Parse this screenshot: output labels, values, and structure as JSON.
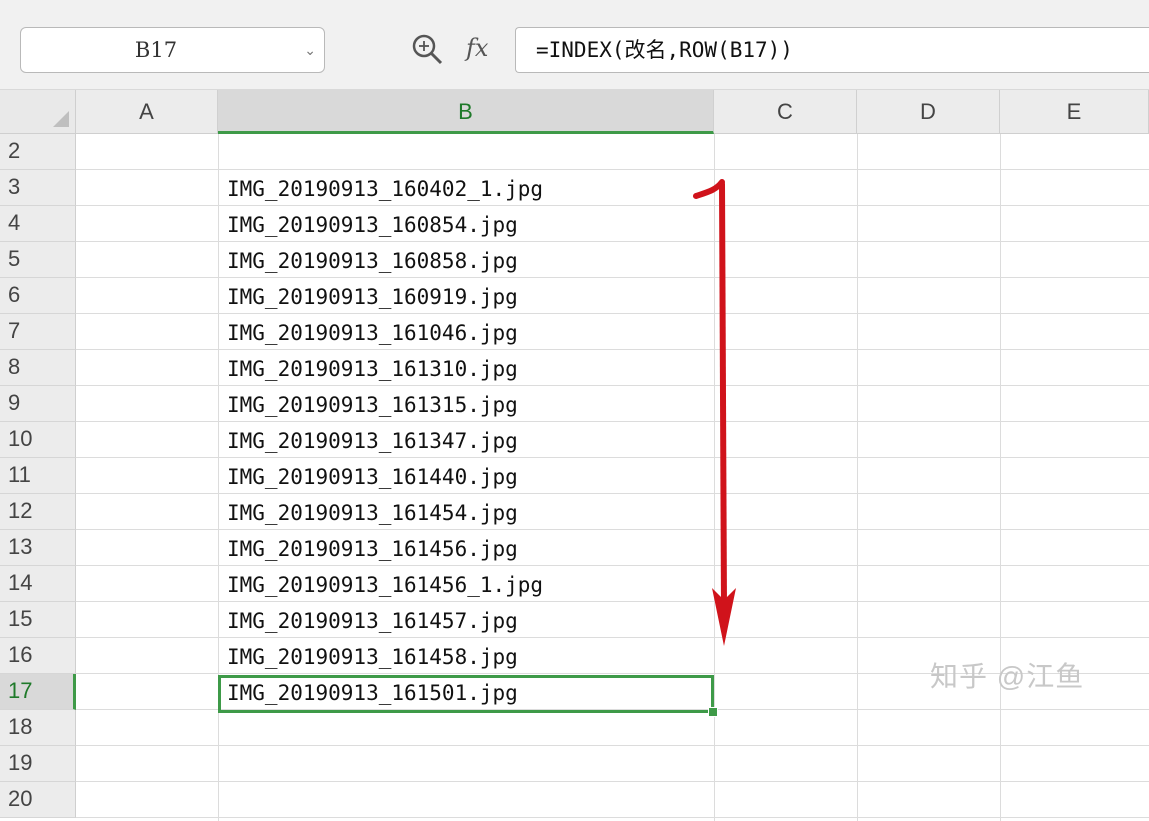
{
  "formula_bar": {
    "name_box_value": "B17",
    "name_box_caret": "⌄",
    "fx_label": "fx",
    "formula": "=INDEX(改名,ROW(B17))"
  },
  "columns": [
    "A",
    "B",
    "C",
    "D",
    "E"
  ],
  "rows": [
    {
      "num": "2",
      "b": ""
    },
    {
      "num": "3",
      "b": "IMG_20190913_160402_1.jpg"
    },
    {
      "num": "4",
      "b": "IMG_20190913_160854.jpg"
    },
    {
      "num": "5",
      "b": "IMG_20190913_160858.jpg"
    },
    {
      "num": "6",
      "b": "IMG_20190913_160919.jpg"
    },
    {
      "num": "7",
      "b": "IMG_20190913_161046.jpg"
    },
    {
      "num": "8",
      "b": "IMG_20190913_161310.jpg"
    },
    {
      "num": "9",
      "b": "IMG_20190913_161315.jpg"
    },
    {
      "num": "10",
      "b": "IMG_20190913_161347.jpg"
    },
    {
      "num": "11",
      "b": "IMG_20190913_161440.jpg"
    },
    {
      "num": "12",
      "b": "IMG_20190913_161454.jpg"
    },
    {
      "num": "13",
      "b": "IMG_20190913_161456.jpg"
    },
    {
      "num": "14",
      "b": "IMG_20190913_161456_1.jpg"
    },
    {
      "num": "15",
      "b": "IMG_20190913_161457.jpg"
    },
    {
      "num": "16",
      "b": "IMG_20190913_161458.jpg"
    },
    {
      "num": "17",
      "b": "IMG_20190913_161501.jpg"
    },
    {
      "num": "18",
      "b": ""
    },
    {
      "num": "19",
      "b": ""
    },
    {
      "num": "20",
      "b": ""
    }
  ],
  "selection": {
    "column": "B",
    "row": "17"
  },
  "watermark": "知乎 @江鱼",
  "colors": {
    "selection_green": "#3e9a48",
    "arrow_red": "#d0131b"
  }
}
